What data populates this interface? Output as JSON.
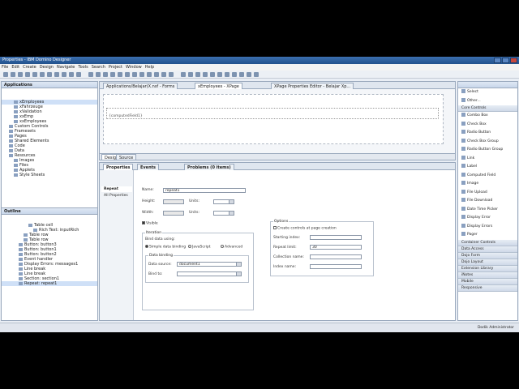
{
  "window": {
    "title": "Properties - IBM Domino Designer"
  },
  "menu": [
    "File",
    "Edit",
    "Create",
    "Design",
    "Navigate",
    "Tools",
    "Search",
    "Project",
    "Window",
    "Help"
  ],
  "applications": {
    "title": "Applications",
    "items": [
      {
        "label": "xEmployees",
        "indent": 2,
        "selected": true
      },
      {
        "label": "xFahrzeuge",
        "indent": 2
      },
      {
        "label": "xValidation",
        "indent": 2
      },
      {
        "label": "xxEmp",
        "indent": 2
      },
      {
        "label": "xxEmployees",
        "indent": 2
      },
      {
        "label": "Custom Controls",
        "indent": 1
      },
      {
        "label": "Framesets",
        "indent": 1
      },
      {
        "label": "Pages",
        "indent": 1
      },
      {
        "label": "Shared Elements",
        "indent": 1
      },
      {
        "label": "Code",
        "indent": 1
      },
      {
        "label": "Data",
        "indent": 1
      },
      {
        "label": "Resources",
        "indent": 1
      },
      {
        "label": "Images",
        "indent": 2
      },
      {
        "label": "Files",
        "indent": 2
      },
      {
        "label": "Applets",
        "indent": 2
      },
      {
        "label": "Style Sheets",
        "indent": 2
      }
    ]
  },
  "outline": {
    "title": "Outline",
    "items": [
      {
        "label": "Table cell",
        "indent": 5
      },
      {
        "label": "Rich Text: inputRich",
        "indent": 6
      },
      {
        "label": "Table row",
        "indent": 4
      },
      {
        "label": "Table row",
        "indent": 4
      },
      {
        "label": "Button: button3",
        "indent": 3
      },
      {
        "label": "Button: button1",
        "indent": 3
      },
      {
        "label": "Button: button2",
        "indent": 3
      },
      {
        "label": "Event handler",
        "indent": 3
      },
      {
        "label": "Display Errors: messages1",
        "indent": 3
      },
      {
        "label": "Line break",
        "indent": 3
      },
      {
        "label": "Line break",
        "indent": 3
      },
      {
        "label": "Section: section1",
        "indent": 3
      },
      {
        "label": "Repeat: repeat1",
        "indent": 3,
        "selected": true
      }
    ]
  },
  "editor": {
    "tabs": [
      {
        "label": "Applications/Belajar(X.nsf - Forms"
      },
      {
        "label": "xEmployees - XPage",
        "active": true
      },
      {
        "label": "XPage Properties Editor - Belajar Xp..."
      }
    ],
    "computed_field": "{computedField1}",
    "bottom_tabs": [
      "Design",
      "Source"
    ]
  },
  "properties": {
    "tabs": [
      "Properties",
      "Events",
      "Problems (0 items)"
    ],
    "left_nav": [
      "Repeat",
      "All Properties"
    ],
    "name_label": "Name:",
    "name_value": "repeat1",
    "height_label": "Height:",
    "width_label": "Width:",
    "units_label": "Units:",
    "visible_label": "Visible",
    "iteration": {
      "title": "Iteration",
      "bind_label": "Bind data using:",
      "options": [
        "Simple data binding",
        "JavaScript",
        "Advanced"
      ],
      "data_binding_title": "Data binding",
      "data_source_label": "Data source:",
      "data_source_value": "document1",
      "bind_to_label": "Bind to:"
    },
    "options": {
      "title": "Options",
      "create_controls": "Create controls at page creation",
      "starting_index": "Starting index:",
      "repeat_limit": "Repeat limit:",
      "repeat_limit_value": "30",
      "collection_name": "Collection name:",
      "index_name": "Index name:"
    }
  },
  "palette": {
    "top_items": [
      "Select",
      "Other..."
    ],
    "core_title": "Core Controls",
    "core_items": [
      "Combo Box",
      "Check Box",
      "Radio Button",
      "Check Box Group",
      "Radio Button Group",
      "Link",
      "Label",
      "Computed Field",
      "Image",
      "File Upload",
      "File Download",
      "Date Time Picker",
      "Display Error",
      "Display Errors",
      "Pager"
    ],
    "categories": [
      "Container Controls",
      "Data Access",
      "Dojo Form",
      "Dojo Layout",
      "Extension Library",
      "iNotes",
      "Mobile",
      "Responsive"
    ]
  },
  "status": {
    "user": "Dodik Administrator"
  }
}
